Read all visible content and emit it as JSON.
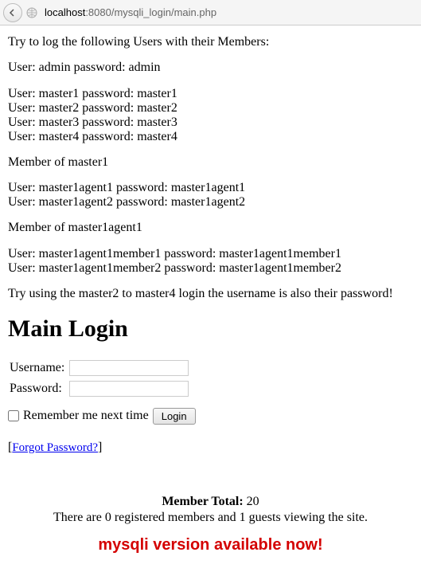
{
  "browser": {
    "url_prefix": "localhost",
    "url_suffix": ":8080/mysqli_login/main.php"
  },
  "intro": "Try to log the following Users with their Members:",
  "admin_line": "User: admin password: admin",
  "masters": [
    "User: master1 password: master1",
    "User: master2 password: master2",
    "User: master3 password: master3",
    "User: master4 password: master4"
  ],
  "member_master1": "Member of master1",
  "agents": [
    "User: master1agent1 password: master1agent1",
    "User: master1agent2 password: master1agent2"
  ],
  "member_agent1": "Member of master1agent1",
  "members": [
    "User: master1agent1member1 password: master1agent1member1",
    "User: master1agent1member2 password: master1agent1member2"
  ],
  "note": "Try using the master2 to master4 login the username is also their password!",
  "heading": "Main Login",
  "form": {
    "username_label": "Username:",
    "password_label": "Password:",
    "remember_label": "Remember me next time",
    "login_btn": "Login"
  },
  "forgot": {
    "left": "[",
    "link": "Forgot Password?",
    "right": "]"
  },
  "stats": {
    "total_label": "Member Total:",
    "total_value": "20",
    "registered_prefix": "There are ",
    "registered_count": "0",
    "registered_mid": " registered members and ",
    "guests_count": "1",
    "guests_suffix": " guests viewing the site."
  },
  "promo": "mysqli version available now!"
}
